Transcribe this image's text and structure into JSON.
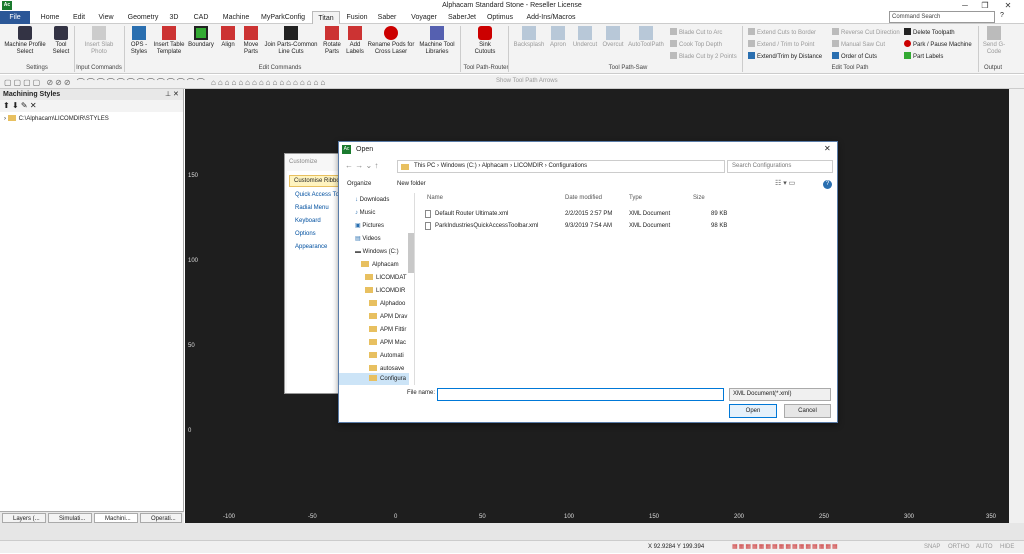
{
  "window": {
    "title": "Alphacam Standard Stone - Reseller License",
    "app_icon": "Ac"
  },
  "menu": {
    "tabs": [
      "File",
      "Home",
      "Edit",
      "View",
      "Geometry",
      "3D",
      "CAD",
      "Machine",
      "MyParkConfig",
      "Titan",
      "Fusion",
      "Saber",
      "Voyager",
      "SaberJet",
      "Optimus",
      "Add-Ins/Macros"
    ],
    "active": "Titan",
    "search_placeholder": "Command Search"
  },
  "ribbon": {
    "buttons": [
      {
        "label": "Machine Profile Select"
      },
      {
        "label": "Tool Select"
      },
      {
        "label": "Insert Slab Photo",
        "disabled": true
      },
      {
        "label": "OPS - Styles"
      },
      {
        "label": "Insert Table Template"
      },
      {
        "label": "Boundary"
      },
      {
        "label": "Align"
      },
      {
        "label": "Move Parts"
      },
      {
        "label": "Join Parts-Common Line Cuts"
      },
      {
        "label": "Rotate Parts"
      },
      {
        "label": "Add Labels"
      },
      {
        "label": "Rename Pods for Cross Laser"
      },
      {
        "label": "Machine Tool Libraries"
      },
      {
        "label": "Sink Cutouts"
      },
      {
        "label": "Backsplash",
        "disabled": true
      },
      {
        "label": "Apron",
        "disabled": true
      },
      {
        "label": "Undercut",
        "disabled": true
      },
      {
        "label": "Overcut",
        "disabled": true
      },
      {
        "label": "AutoToolPath",
        "disabled": true
      }
    ],
    "small": {
      "saw": [
        "Blade Cut to Arc",
        "Cook Top Depth",
        "Blade Cut by 2 Points"
      ],
      "edit": [
        "Extend Cuts to Border",
        "Extend / Trim to Point",
        "Extend/Trim by Distance"
      ],
      "edit2": [
        "Reverse Cut Direction",
        "Manual Saw Cut",
        "Order of Cuts"
      ],
      "tp": [
        "Delete Toolpath",
        "Park / Pause Machine",
        "Part Labels"
      ]
    },
    "send": "Send G-Code",
    "groups": [
      "Settings",
      "Input Commands",
      "Edit Commands",
      "Tool Path-Router",
      "Tool Path-Saw",
      "Edit Tool Path",
      "Output"
    ]
  },
  "qat": {
    "show_arrows": "Show Tool Path Arrows"
  },
  "left_panel": {
    "title": "Machining Styles",
    "tree_item": "C:\\Alphacam\\LICOMDIR\\STYLES",
    "tabs": [
      "Layers (...",
      "Simulati...",
      "Machini...",
      "Operati..."
    ],
    "active_tab": "Machini..."
  },
  "axes": {
    "y_labels": [
      "150",
      "100",
      "50",
      "0"
    ],
    "x_labels": [
      "-100",
      "-50",
      "0",
      "50",
      "100",
      "150",
      "200",
      "250",
      "300",
      "350"
    ]
  },
  "customize": {
    "title": "Customize",
    "items": [
      "Customise Ribbon",
      "Quick Access Toolbar",
      "Radial Menu",
      "Keyboard",
      "Options",
      "Appearance"
    ]
  },
  "dialog": {
    "title": "Open",
    "breadcrumb": [
      "This PC",
      "Windows (C:)",
      "Alphacam",
      "LICOMDIR",
      "Configurations"
    ],
    "search_placeholder": "Search Configurations",
    "organize": "Organize",
    "new_folder": "New folder",
    "nav": [
      "Downloads",
      "Music",
      "Pictures",
      "Videos",
      "Windows (C:)",
      "Alphacam",
      "LICOMDAT",
      "LICOMDIR",
      "Alphadoo",
      "APM Drav",
      "APM Fittir",
      "APM Mac",
      "Automati",
      "autosave",
      "Configura"
    ],
    "columns": [
      "Name",
      "Date modified",
      "Type",
      "Size"
    ],
    "files": [
      {
        "name": "Default Router Ultimate.xml",
        "date": "2/2/2015 2:57 PM",
        "type": "XML Document",
        "size": "89 KB"
      },
      {
        "name": "ParkIndustriesQuickAccessToolbar.xml",
        "date": "9/3/2019 7:54 AM",
        "type": "XML Document",
        "size": "98 KB"
      }
    ],
    "file_name_label": "File name:",
    "file_name_value": "",
    "file_type": "XML Document(*.xml)",
    "open_label": "Open",
    "cancel_label": "Cancel"
  },
  "status": {
    "coords": "X 92.9284  Y 199.394",
    "snap": "SNAP",
    "ortho": "ORTHO",
    "auto": "AUTO",
    "hide": "HIDE"
  }
}
